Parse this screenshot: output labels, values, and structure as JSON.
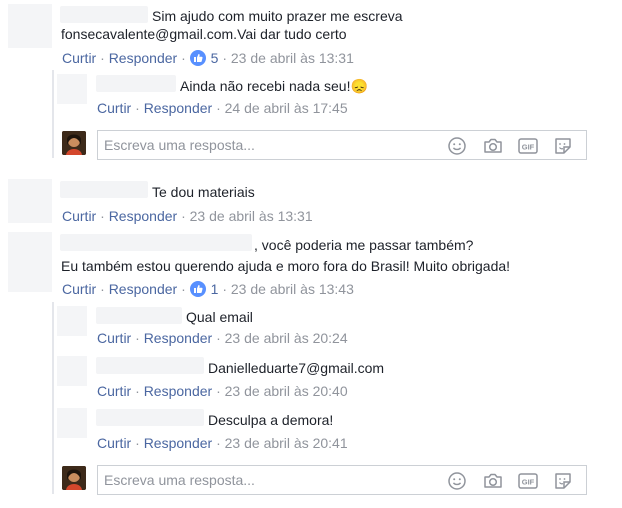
{
  "comments": [
    {
      "text_line1": "Sim ajudo com muito prazer me escreva",
      "text_line2": "fonsecavalente@gmail.com.Vai dar tudo certo",
      "like": "Curtir",
      "reply": "Responder",
      "reactions": "5",
      "time": "23 de abril às 13:31",
      "replies": [
        {
          "text": "Ainda não recebi nada seu!😞",
          "like": "Curtir",
          "reply": "Responder",
          "time": "24 de abril às 17:45"
        }
      ]
    },
    {
      "text_line1": "Te dou materiais",
      "like": "Curtir",
      "reply": "Responder",
      "time": "23 de abril às 13:31"
    },
    {
      "text_line1": ", você poderia me passar também?",
      "text_line2": "Eu também estou querendo ajuda e moro fora do Brasil! Muito obrigada!",
      "like": "Curtir",
      "reply": "Responder",
      "reactions": "1",
      "time": "23 de abril às 13:43",
      "replies": [
        {
          "text": "Qual email",
          "like": "Curtir",
          "reply": "Responder",
          "time": "23 de abril às 20:24"
        },
        {
          "text": "Danielleduarte7@gmail.com",
          "like": "Curtir",
          "reply": "Responder",
          "time": "23 de abril às 20:40"
        },
        {
          "text": "Desculpa a demora!",
          "like": "Curtir",
          "reply": "Responder",
          "time": "23 de abril às 20:41"
        }
      ]
    }
  ],
  "reply_input": {
    "placeholder": "Escreva uma resposta..."
  },
  "icons": {
    "emoji": "smiley-icon",
    "camera": "camera-icon",
    "gif": "gif-icon",
    "sticker": "sticker-icon",
    "gif_label": "GIF"
  },
  "colors": {
    "link": "#4b67a1",
    "meta": "#90949c",
    "like_badge": "#5890ff"
  }
}
